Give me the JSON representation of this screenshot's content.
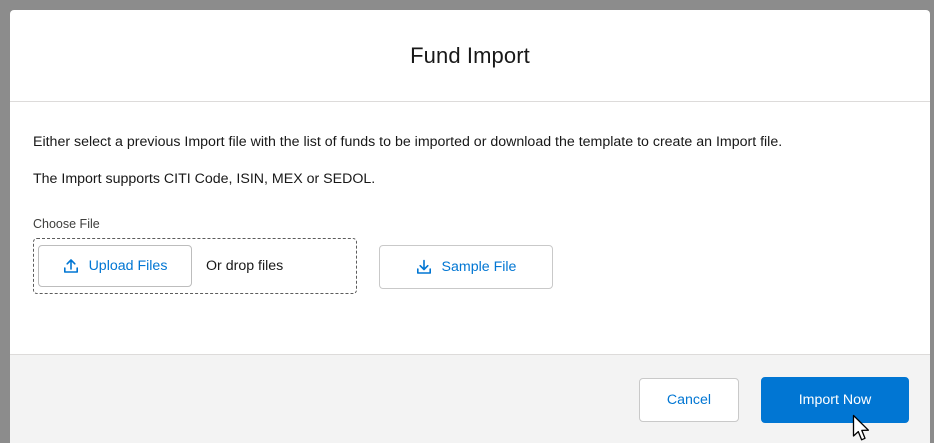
{
  "modal": {
    "title": "Fund Import",
    "description": "Either select a previous Import file with the list of funds to be imported or download the template to create an Import file.",
    "supports": "The Import supports CITI Code, ISIN, MEX or SEDOL."
  },
  "file_input": {
    "label": "Choose File",
    "upload_label": "Upload Files",
    "drop_text": "Or drop files",
    "upload_icon": "upload-icon"
  },
  "sample": {
    "label": "Sample File",
    "icon": "download-icon"
  },
  "footer": {
    "cancel_label": "Cancel",
    "import_label": "Import Now"
  },
  "colors": {
    "brand": "#0176d3",
    "backdrop": "#8c8c8c",
    "footer_bg": "#f3f3f3"
  }
}
